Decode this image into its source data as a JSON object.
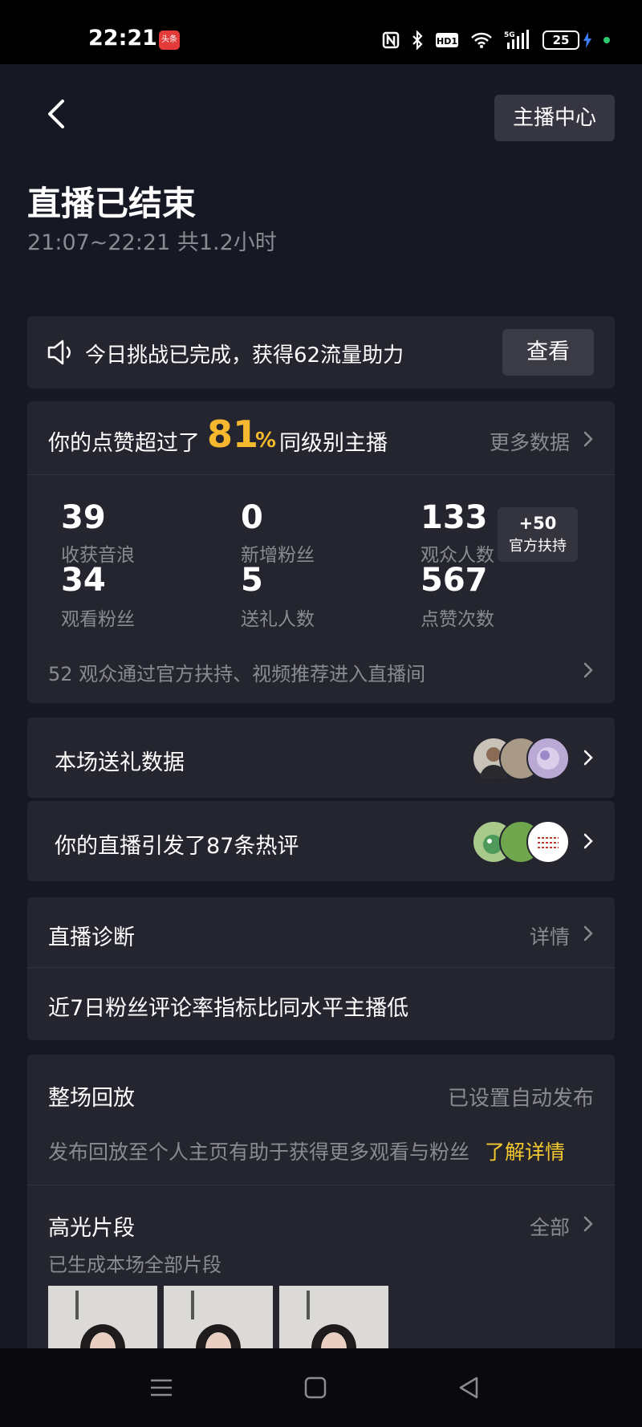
{
  "status_bar": {
    "time": "22:21",
    "app_badge": "头条",
    "network": "5G",
    "hd": "HD1",
    "battery": "25",
    "icons": [
      "nfc-icon",
      "bluetooth-icon",
      "hd-icon",
      "wifi-icon",
      "signal-icon",
      "battery-icon",
      "charging-icon"
    ]
  },
  "header": {
    "back_icon": "chevron-left-icon",
    "anchor_center_label": "主播中心",
    "title": "直播已结束",
    "subtitle": "21:07~22:21 共1.2小时"
  },
  "challenge": {
    "icon": "speaker-icon",
    "text": "今日挑战已完成，获得62流量助力",
    "button": "查看"
  },
  "stats": {
    "head_pre": "你的点赞超过了",
    "percent": "81",
    "percent_sign": "%",
    "head_post": "同级别主播",
    "more_label": "更多数据",
    "items": [
      {
        "value": "39",
        "label": "收获音浪"
      },
      {
        "value": "0",
        "label": "新增粉丝"
      },
      {
        "value": "133",
        "label": "观众人数"
      },
      {
        "value": "34",
        "label": "观看粉丝"
      },
      {
        "value": "5",
        "label": "送礼人数"
      },
      {
        "value": "567",
        "label": "点赞次数"
      }
    ],
    "support_value": "+50",
    "support_label": "官方扶持",
    "footer": "52 观众通过官方扶持、视频推荐进入直播间"
  },
  "gift_row": {
    "label": "本场送礼数据"
  },
  "comment_row": {
    "label": "你的直播引发了87条热评"
  },
  "diagnosis": {
    "title": "直播诊断",
    "detail_label": "详情",
    "body": "近7日粉丝评论率指标比同水平主播低"
  },
  "replay": {
    "title": "整场回放",
    "status": "已设置自动发布",
    "desc": "发布回放至个人主页有助于获得更多观看与粉丝",
    "link": "了解详情",
    "highlight_title": "高光片段",
    "highlight_all": "全部",
    "highlight_sub": "已生成本场全部片段"
  },
  "colors": {
    "background": "#161823",
    "card": "#24252f",
    "accent_gold": "#f5b82e",
    "link_yellow": "#f5c82e",
    "muted_text": "#8a8b91"
  }
}
